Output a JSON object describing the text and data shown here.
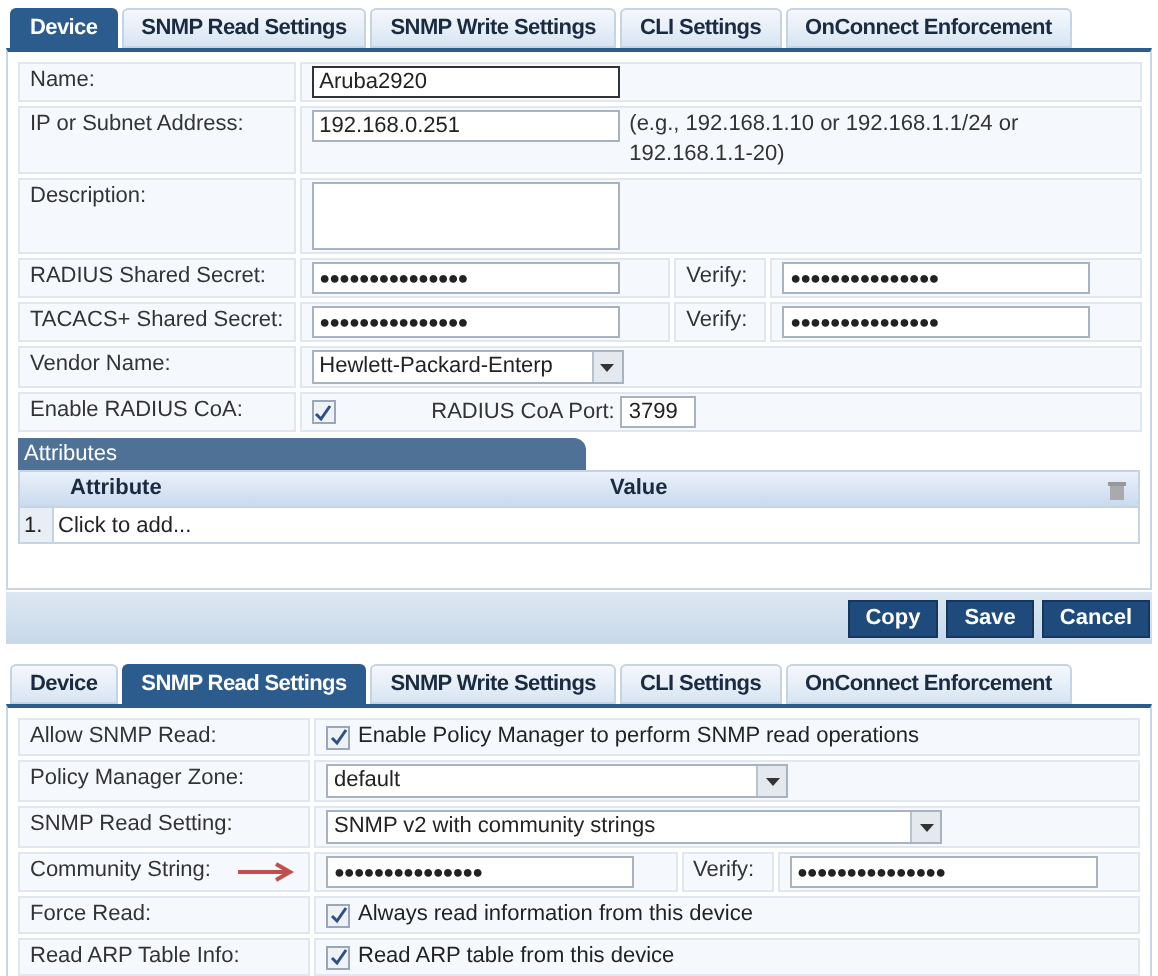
{
  "panels": [
    {
      "tabs": [
        {
          "label": "Device",
          "selected": true
        },
        {
          "label": "SNMP Read Settings",
          "selected": false
        },
        {
          "label": "SNMP Write Settings",
          "selected": false
        },
        {
          "label": "CLI Settings",
          "selected": false
        },
        {
          "label": "OnConnect Enforcement",
          "selected": false
        }
      ],
      "rows": [
        {
          "kind": "text",
          "label": "Name:",
          "value": "Aruba2920",
          "focused": true
        },
        {
          "kind": "text",
          "label": "IP or Subnet Address:",
          "value": "192.168.0.251",
          "hint": "(e.g., 192.168.1.10 or 192.168.1.1/24 or 192.168.1.1-20)",
          "focused": false
        },
        {
          "kind": "textarea",
          "label": "Description:"
        },
        {
          "kind": "secret",
          "label": "RADIUS Shared Secret:",
          "value": "●●●●●●●●●●●●●●●",
          "verify_label": "Verify:",
          "verify_value": "●●●●●●●●●●●●●●●",
          "arrow": false
        },
        {
          "kind": "secret",
          "label": "TACACS+ Shared Secret:",
          "value": "●●●●●●●●●●●●●●●",
          "verify_label": "Verify:",
          "verify_value": "●●●●●●●●●●●●●●●",
          "arrow": false
        },
        {
          "kind": "select",
          "label": "Vendor Name:",
          "value": "Hewlett-Packard-Enterp"
        },
        {
          "kind": "coa",
          "label": "Enable RADIUS CoA:",
          "checked": true,
          "port_label": "RADIUS CoA Port:",
          "port_value": "3799"
        }
      ],
      "attributes": {
        "title": "Attributes",
        "columns": [
          "Attribute",
          "Value"
        ],
        "rows": [
          {
            "index": "1.",
            "text": "Click to add..."
          }
        ]
      },
      "buttons": [
        "Copy",
        "Save",
        "Cancel"
      ]
    },
    {
      "tabs": [
        {
          "label": "Device",
          "selected": false
        },
        {
          "label": "SNMP Read Settings",
          "selected": true
        },
        {
          "label": "SNMP Write Settings",
          "selected": false
        },
        {
          "label": "CLI Settings",
          "selected": false
        },
        {
          "label": "OnConnect Enforcement",
          "selected": false
        }
      ],
      "rows": [
        {
          "kind": "checkbox",
          "label": "Allow SNMP Read:",
          "checked": true,
          "text": "Enable Policy Manager to perform SNMP read operations"
        },
        {
          "kind": "select",
          "label": "Policy Manager Zone:",
          "value": "default"
        },
        {
          "kind": "select",
          "label": "SNMP Read Setting:",
          "value": "SNMP v2 with community strings"
        },
        {
          "kind": "secret",
          "label": "Community String:",
          "value": "●●●●●●●●●●●●●●●",
          "verify_label": "Verify:",
          "verify_value": "●●●●●●●●●●●●●●●",
          "arrow": true
        },
        {
          "kind": "checkbox",
          "label": "Force Read:",
          "checked": true,
          "text": "Always read information from this device"
        },
        {
          "kind": "checkbox",
          "label": "Read ARP Table Info:",
          "checked": true,
          "text": "Read ARP table from this device"
        }
      ]
    }
  ]
}
